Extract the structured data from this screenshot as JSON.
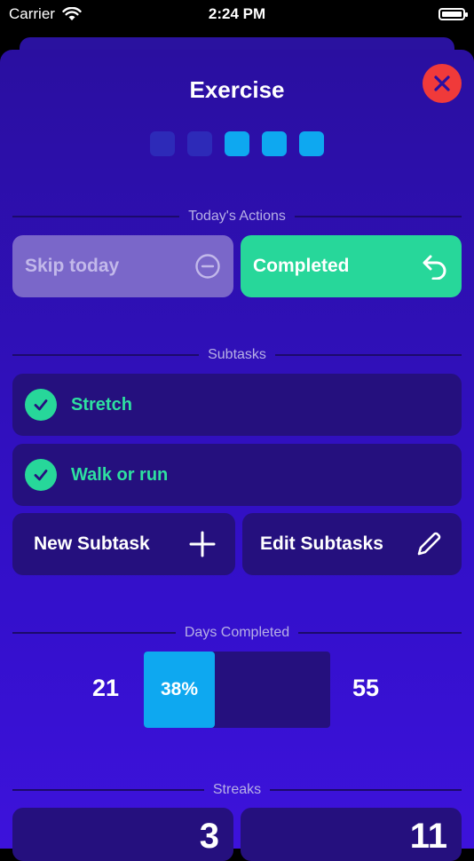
{
  "status_bar": {
    "carrier": "Carrier",
    "time": "2:24 PM"
  },
  "sheet": {
    "title": "Exercise"
  },
  "progress_dots": [
    "dim",
    "dim",
    "lit",
    "lit",
    "lit"
  ],
  "sections": {
    "todays_actions": "Today's Actions",
    "subtasks": "Subtasks",
    "days_completed": "Days Completed",
    "streaks": "Streaks"
  },
  "actions": {
    "skip_label": "Skip today",
    "completed_label": "Completed"
  },
  "subtasks": [
    {
      "label": "Stretch",
      "done": true
    },
    {
      "label": "Walk or run",
      "done": true
    }
  ],
  "subtask_buttons": {
    "new_label": "New Subtask",
    "edit_label": "Edit Subtasks"
  },
  "days_completed": {
    "completed": "21",
    "total": "55",
    "percent_label": "38%",
    "fraction": 0.38
  },
  "streaks": {
    "current": "3",
    "best": "11"
  },
  "colors": {
    "accent_green": "#27d79a",
    "accent_blue": "#0ea8f0",
    "close_red": "#f03a3a"
  }
}
